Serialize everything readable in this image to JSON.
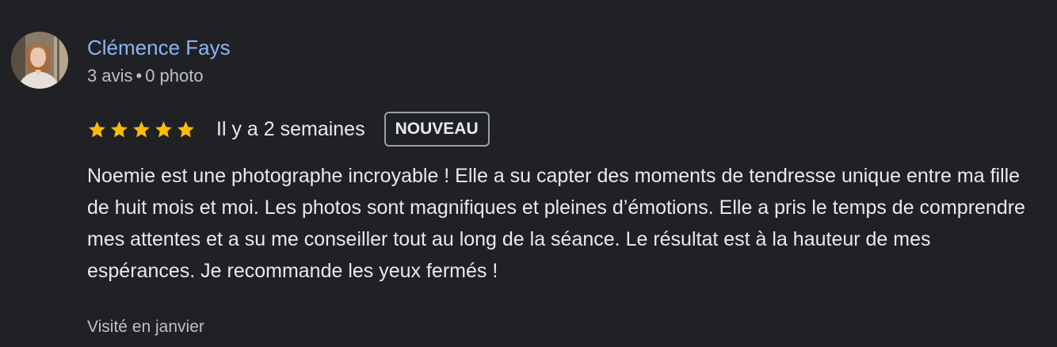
{
  "reviewer": {
    "name": "Clémence Fays",
    "reviews": "3 avis",
    "separator": "•",
    "photos": "0 photo"
  },
  "review": {
    "rating": 5,
    "max_rating": 5,
    "star_color": "#fbbc04",
    "date": "Il y a 2 semaines",
    "badge": "NOUVEAU",
    "text": "Noemie est une photographe incroyable ! Elle a su capter des moments de tendresse unique entre ma fille de huit mois et moi. Les photos sont magnifiques et pleines d’émotions. Elle a pris le temps de comprendre mes attentes et a su me conseiller tout au long de la séance. Le résultat est à la hauteur de mes espérances. Je recommande les yeux fermés !",
    "visited": "Visité en janvier"
  },
  "colors": {
    "background": "#202124",
    "name_link": "#8ab4f8",
    "primary_text": "#e8eaed",
    "secondary_text": "#bdc1c6"
  }
}
